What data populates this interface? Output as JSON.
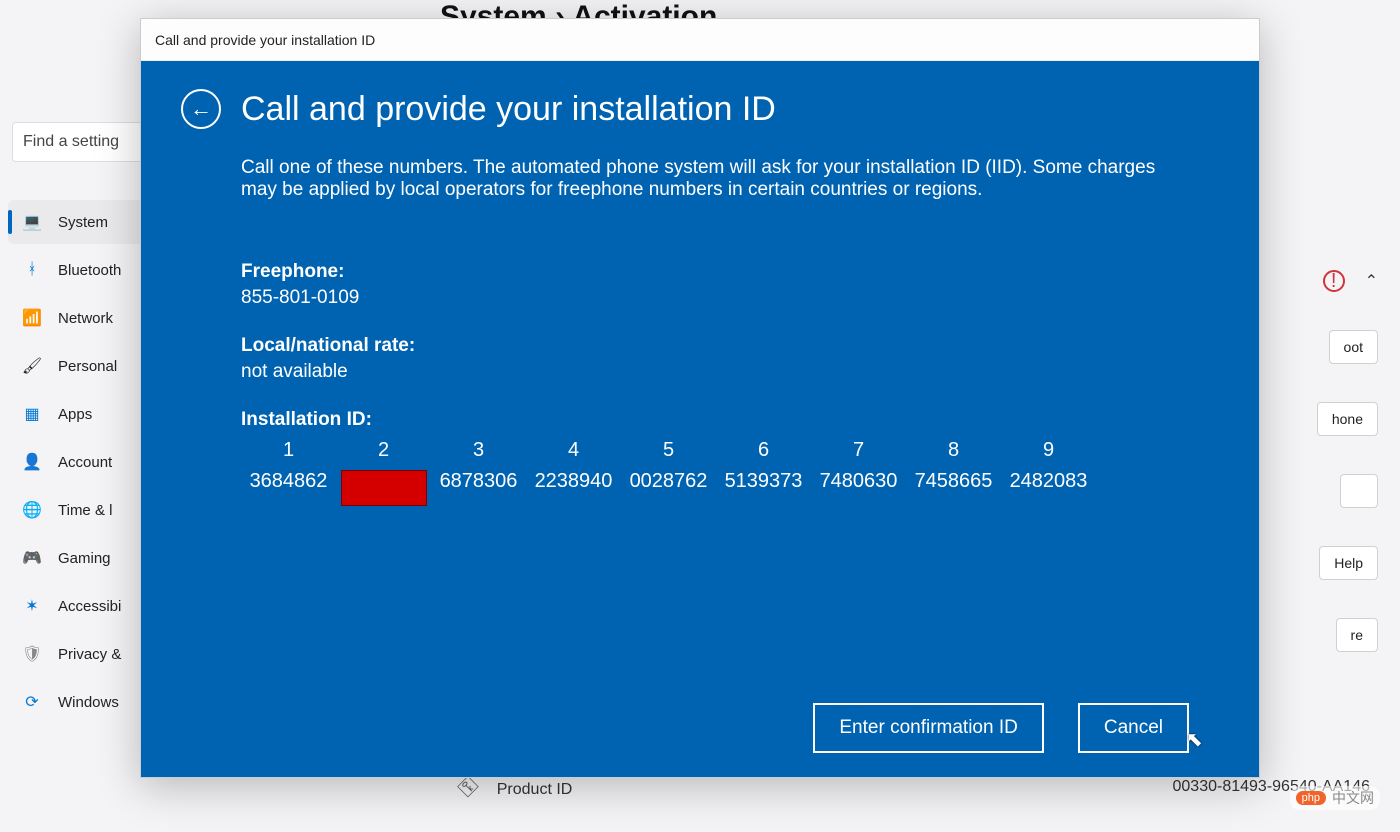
{
  "bg": {
    "header_partial": "System › Activation",
    "search_placeholder": "Find a setting",
    "sidebar": [
      {
        "icon": "💻",
        "label": "System",
        "name": "sidebar-item-system",
        "active": true
      },
      {
        "icon": "ᚼ",
        "label": "Bluetooth",
        "name": "sidebar-item-bluetooth",
        "icon_color": "#0078d4"
      },
      {
        "icon": "📶",
        "label": "Network",
        "name": "sidebar-item-network",
        "icon_color": "#0078d4"
      },
      {
        "icon": "🖌",
        "label": "Personal",
        "name": "sidebar-item-personalization"
      },
      {
        "icon": "▦",
        "label": "Apps",
        "name": "sidebar-item-apps",
        "icon_color": "#0078d4"
      },
      {
        "icon": "👤",
        "label": "Account",
        "name": "sidebar-item-accounts",
        "icon_color": "#2e8b57"
      },
      {
        "icon": "🌐",
        "label": "Time & l",
        "name": "sidebar-item-time",
        "icon_color": "#0078d4"
      },
      {
        "icon": "🎮",
        "label": "Gaming",
        "name": "sidebar-item-gaming",
        "icon_color": "#666"
      },
      {
        "icon": "✶",
        "label": "Accessibi",
        "name": "sidebar-item-accessibility",
        "icon_color": "#0078d4"
      },
      {
        "icon": "🛡",
        "label": "Privacy &",
        "name": "sidebar-item-privacy",
        "icon_color": "#888"
      },
      {
        "icon": "⟳",
        "label": "Windows",
        "name": "sidebar-item-windows-update",
        "icon_color": "#0078d4"
      }
    ],
    "peek_buttons": [
      "oot",
      "hone",
      "",
      "Help",
      "re"
    ],
    "product_id_label": "Product ID",
    "product_id_value": "00330-81493-96540-AA146"
  },
  "dialog": {
    "titlebar": "Call and provide your installation ID",
    "title": "Call and provide your installation ID",
    "description": "Call one of these numbers. The automated phone system will ask for your installation ID (IID). Some charges may be applied by local operators for freephone numbers in certain countries or regions.",
    "freephone_label": "Freephone:",
    "freephone_value": "855-801-0109",
    "rate_label": "Local/national rate:",
    "rate_value": "not available",
    "iid_label": "Installation ID:",
    "iid_headers": [
      "1",
      "2",
      "3",
      "4",
      "5",
      "6",
      "7",
      "8",
      "9"
    ],
    "iid_values": [
      "3684862",
      "",
      "6878306",
      "2238940",
      "0028762",
      "5139373",
      "7480630",
      "7458665",
      "2482083"
    ],
    "iid_redacted_index": 1,
    "btn_confirm": "Enter confirmation ID",
    "btn_cancel": "Cancel"
  },
  "watermark": {
    "badge": "php",
    "text": "中文网"
  }
}
